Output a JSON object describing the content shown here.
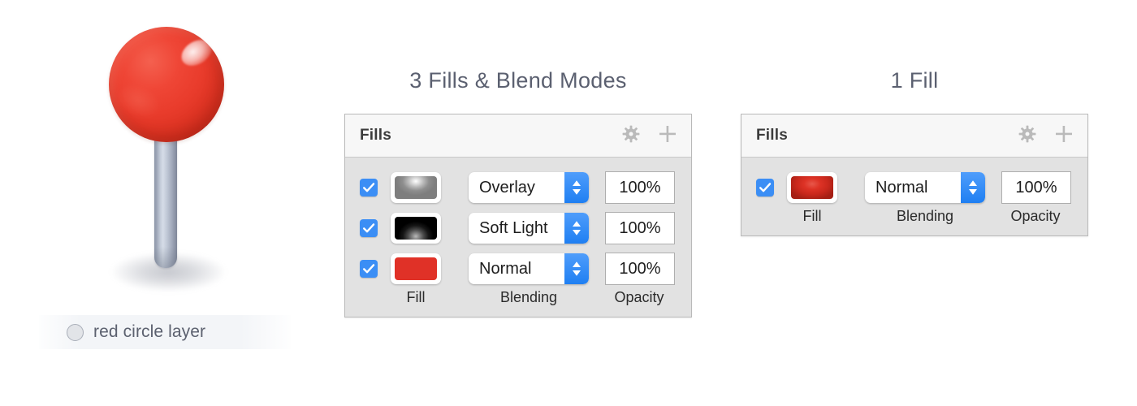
{
  "illustration": {
    "pin": {
      "name": "red-pin-graphic",
      "ball_color": "#e93c2c",
      "needle_color": "#b9c2d1"
    },
    "layer_label": {
      "text": "red circle layer",
      "icon": "circle-icon"
    }
  },
  "panels": [
    {
      "title": "3 Fills & Blend Modes",
      "header": {
        "title": "Fills",
        "gear_icon": "gear-icon",
        "add_icon": "plus-icon"
      },
      "columns": {
        "fill": "Fill",
        "blending": "Blending",
        "opacity": "Opacity"
      },
      "rows": [
        {
          "enabled": true,
          "swatch": "gray-radial",
          "blend_mode": "Overlay",
          "opacity": "100%"
        },
        {
          "enabled": true,
          "swatch": "black-radial",
          "blend_mode": "Soft Light",
          "opacity": "100%"
        },
        {
          "enabled": true,
          "swatch": "red-flat",
          "blend_mode": "Normal",
          "opacity": "100%"
        }
      ]
    },
    {
      "title": "1 Fill",
      "header": {
        "title": "Fills",
        "gear_icon": "gear-icon",
        "add_icon": "plus-icon"
      },
      "columns": {
        "fill": "Fill",
        "blending": "Blending",
        "opacity": "Opacity"
      },
      "rows": [
        {
          "enabled": true,
          "swatch": "red-gradient",
          "blend_mode": "Normal",
          "opacity": "100%"
        }
      ]
    }
  ],
  "colors": {
    "accent_blue": "#3b8ef5",
    "red_fill": "#e03127",
    "title_gray": "#5b6070",
    "panel_body": "#e2e2e2",
    "panel_header": "#f7f7f7"
  }
}
